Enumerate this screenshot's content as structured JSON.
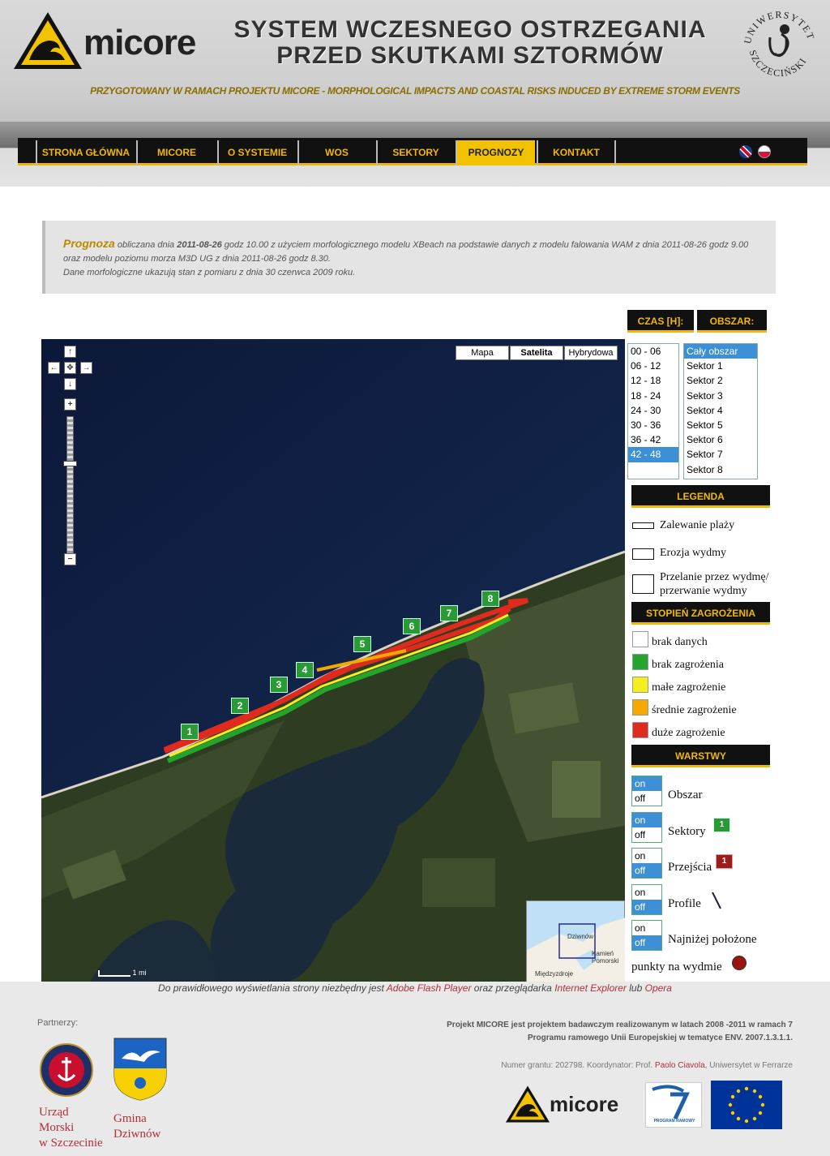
{
  "header": {
    "logo_text": "micore",
    "title_line1": "SYSTEM WCZESNEGO OSTRZEGANIA",
    "title_line2": "PRZED SKUTKAMI SZTORMÓW",
    "subtitle": "PRZYGOTOWANY W RAMACH PROJEKTU MICORE - MORPHOLOGICAL IMPACTS AND COASTAL RISKS INDUCED BY EXTREME STORM EVENTS",
    "university_logo_text_top": "UNIWERSYTET",
    "university_logo_text_bottom": "SZCZECIŃSKI"
  },
  "nav": {
    "items": [
      {
        "label": "STRONA GŁÓWNA"
      },
      {
        "label": "MICORE"
      },
      {
        "label": "O SYSTEMIE"
      },
      {
        "label": "WOS"
      },
      {
        "label": "SEKTORY"
      },
      {
        "label": "PROGNOZY"
      },
      {
        "label": "KONTAKT"
      }
    ],
    "active_index": 5
  },
  "forecast": {
    "label": "Prognoza",
    "text1": " obliczana dnia ",
    "date1": "2011-08-26",
    "text2": " godz 10.00 z użyciem morfologicznego modelu XBeach na podstawie danych z modelu falowania WAM z dnia 2011-08-26 godz 9.00 oraz modelu poziomu morza M3D UG z dnia 2011-08-26 godz 8.30.",
    "text3": "Dane morfologiczne ukazują stan z pomiaru z dnia 30 czerwca 2009 roku."
  },
  "map": {
    "types": [
      "Mapa",
      "Satelita",
      "Hybrydowa"
    ],
    "selected_type": "Satelita",
    "scale_label": "1 mi",
    "sector_markers": [
      "1",
      "2",
      "3",
      "4",
      "5",
      "6",
      "7",
      "8"
    ],
    "minimap_labels": [
      "Dziwnów",
      "Kamień Pomorski",
      "Międzyzdroje"
    ]
  },
  "controls": {
    "time_header": "CZAS [H]:",
    "area_header": "OBSZAR:",
    "time_options": [
      "00 - 06",
      "06 - 12",
      "12 - 18",
      "18 - 24",
      "24 - 30",
      "30 - 36",
      "36 - 42",
      "42 - 48"
    ],
    "time_selected": "42 - 48",
    "area_options": [
      "Cały obszar",
      "Sektor 1",
      "Sektor 2",
      "Sektor 3",
      "Sektor 4",
      "Sektor 5",
      "Sektor 6",
      "Sektor 7",
      "Sektor 8"
    ],
    "area_selected": "Cały obszar"
  },
  "legend": {
    "header": "LEGENDA",
    "items": [
      "Zalewanie plaży",
      "Erozja wydmy",
      "Przelanie przez wydmę/",
      "przerwanie wydmy"
    ],
    "threat_header": "STOPIEŃ ZAGROŻENIA",
    "threat_levels": [
      {
        "label": "brak danych",
        "color": "#ffffff"
      },
      {
        "label": "brak zagrożenia",
        "color": "#22a52a"
      },
      {
        "label": "małe zagrożenie",
        "color": "#f2ef1c"
      },
      {
        "label": "średnie zagrożenie",
        "color": "#f5a800"
      },
      {
        "label": "duże zagrożenie",
        "color": "#e02a1e"
      }
    ]
  },
  "layers": {
    "header": "WARSTWY",
    "on_label": "on",
    "off_label": "off",
    "items": [
      {
        "label": "Obszar",
        "state": "on"
      },
      {
        "label": "Sektory",
        "state": "on"
      },
      {
        "label": "Przejścia",
        "state": "off"
      },
      {
        "label": "Profile",
        "state": "off"
      },
      {
        "label": "Najniżej położone",
        "state": "off"
      }
    ],
    "last_label_line2": "punkty na wydmie",
    "marker_number": "1"
  },
  "footer": {
    "note_prefix": "Do prawidłowego wyświetlania strony niezbędny jest ",
    "flash": "Adobe Flash Player",
    "note_mid": " oraz przeglądarka ",
    "ie": "Internet Explorer",
    "note_or": " lub ",
    "opera": "Opera",
    "partners_label": "Partnerzy:",
    "partner1": [
      "Urząd",
      "Morski",
      "w Szczecinie"
    ],
    "partner2": [
      "Gmina",
      "Dziwnów"
    ],
    "project_desc_line1": "Projekt MICORE jest projektem badawczym realizowanym w latach 2008 -2011 w ramach 7",
    "project_desc_line2": "Programu ramowego Unii Europejskiej w tematyce ENV. 2007.1.3.1.1.",
    "grant_prefix": "Numer grantu: 202798. Koordynator: Prof. ",
    "coordinator": "Paolo Ciavola",
    "grant_suffix": ", Uniwersytet w Ferrarze",
    "logo_text": "micore",
    "fp7_text": "PROGRAM RAMOWY"
  },
  "colors": {
    "accent": "#f0b800",
    "nav_bg": "#111111",
    "link": "#b0303a",
    "selected": "#3d8fd6"
  }
}
